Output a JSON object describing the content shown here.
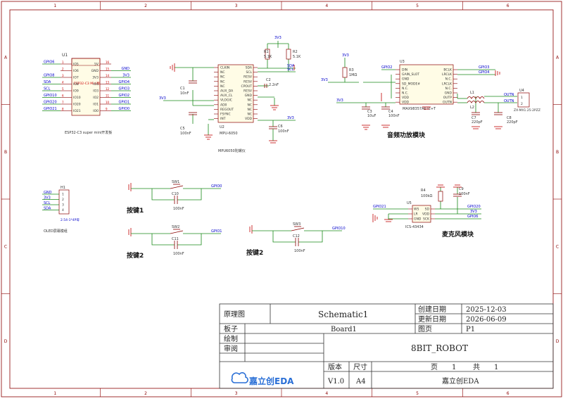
{
  "frame": {
    "cols": [
      "1",
      "2",
      "3",
      "4",
      "5",
      "6"
    ],
    "rows": [
      "A",
      "B",
      "C",
      "D"
    ]
  },
  "colors": {
    "border": "#8b0000",
    "wire": "#1a8a1a",
    "net": "#0000cc",
    "label": "#cc0000",
    "text": "#333333",
    "ground": "#c00000"
  },
  "esp32": {
    "ref": "U1",
    "name": "ESP32-C3\nMini板",
    "caption": "ESP32-C3 super mini开发板",
    "pins_left": [
      "IO5",
      "IO6",
      "IO7",
      "IO8",
      "IO9",
      "IO10",
      "IO20",
      "IO21"
    ],
    "pins_right": [
      "5V",
      "GND",
      "3V3",
      "IO4",
      "IO3",
      "IO2",
      "IO1",
      "IO0"
    ],
    "nums_left": [
      "1",
      "2",
      "3",
      "4",
      "5",
      "6",
      "7",
      "8"
    ],
    "nums_right": [
      "16",
      "15",
      "14",
      "13",
      "12",
      "11",
      "10",
      "9"
    ],
    "nets_left": [
      "GPIO6",
      "",
      "GPIO8",
      "SDA",
      "SCL",
      "GPIO10",
      "GPIO20",
      "GPIO21"
    ],
    "nets_right": [
      "GND",
      "3V3",
      "GPIO4",
      "GPIO3",
      "GPIO2",
      "GPIO1",
      "GPIO0",
      ""
    ]
  },
  "mpu": {
    "ref": "U2",
    "name": "MPU-6050",
    "caption": "MPU6050陀螺仪",
    "pins_left": [
      "CLKIN",
      "NC",
      "NC",
      "NC",
      "NC",
      "AUX_DA",
      "AUX_CL",
      "VLOGIC",
      "AD0",
      "REGOUT",
      "FSYNC",
      "INT"
    ],
    "pins_right": [
      "SDA",
      "SCL",
      "RESV",
      "RESV",
      "CPOUT",
      "RESV",
      "GND",
      "NC",
      "NC",
      "NC",
      "NC",
      "VDD"
    ],
    "net_sda": "SDA",
    "net_scl": "SCL",
    "net_3v3_right": "3V3",
    "net_3v3_left": "3V3",
    "net_3v3_top": "3V3",
    "r1": "R1",
    "r1v": "5.1K",
    "r2": "R2",
    "r2v": "5.1K",
    "c1": "C1",
    "c1v": "10nF",
    "c2": "C2",
    "c2v": "2.2nF",
    "c5": "C5",
    "c5v": "100nF",
    "c6": "C6",
    "c6v": "100nF"
  },
  "amp": {
    "ref": "U3",
    "name": "MAX98357AETE+T",
    "caption": "音频功放模块",
    "pins_left": [
      "DIN",
      "GAIN_SLOT",
      "GND",
      "SD_MODE#",
      "N.C.",
      "N.C.",
      "VDD",
      "VDD"
    ],
    "pins_right": [
      "BCLK",
      "LRCLK",
      "N.C.",
      "LRCLK",
      "N.C.",
      "GND",
      "OUTP",
      "OUTN"
    ],
    "net_in": "GPIO2",
    "net_bclk": "GPIO3",
    "net_lrclk": "GPIO4",
    "net_3v3_a": "3V3",
    "net_3v3_b": "3V3",
    "net_3v3_top": "3V3",
    "r3": "R3",
    "r3v": "1MΩ",
    "c3": "C3",
    "c3v": "10uF",
    "c4": "C4",
    "c4v": "100nF",
    "l1": "L1",
    "l2": "L2",
    "c7": "C7",
    "c7v": "220pF",
    "c8": "C8",
    "c8v": "220pF",
    "u4": "U4",
    "u4name": "ZX-MX1.25-2PZZ",
    "outp": "OUTN",
    "outn": "OUTN"
  },
  "oled": {
    "ref": "H1",
    "nets": [
      "GND",
      "3V3",
      "SCL",
      "SDA"
    ],
    "nums": [
      "1",
      "2",
      "3",
      "4"
    ],
    "part": "2.54-1*4P母",
    "caption": "OLED屏幕模组"
  },
  "keys": [
    {
      "sw": "SW1",
      "cap": "C10",
      "capv": "100nF",
      "net": "GPIO0",
      "caption": "按键1"
    },
    {
      "sw": "SW2",
      "cap": "C11",
      "capv": "100nF",
      "net": "GPIO1",
      "caption": "按键2"
    },
    {
      "sw": "SW3",
      "cap": "C12",
      "capv": "100nF",
      "net": "GPIO10",
      "caption": "按键2"
    }
  ],
  "mic": {
    "ref": "U5",
    "name": "ICS-43434",
    "caption": "麦克风模块",
    "pins_left": [
      "WS",
      "LR",
      "GND"
    ],
    "pins_right": [
      "SD",
      "VDD",
      "SCK"
    ],
    "net_ws": "GPIO21",
    "net_sd": "GPIO20",
    "net_vdd": "3V3",
    "net_sck": "GPIO6",
    "r4": "R4",
    "r4v": "100kΩ",
    "c9": "C9",
    "c9v": "100nF"
  },
  "titleblock": {
    "l_schematic": "原理图",
    "schematic": "Schematic1",
    "l_created": "创建日期",
    "created": "2025-12-03",
    "l_updated": "更新日期",
    "updated": "2026-06-09",
    "l_board": "板子",
    "board": "Board1",
    "l_page": "图页",
    "page": "P1",
    "l_drawn": "绘制",
    "l_review": "审阅",
    "project": "8BIT_ROBOT",
    "l_version": "版本",
    "l_size": "尺寸",
    "l_sheet": "页",
    "sheet": "1",
    "l_total": "共",
    "total": "1",
    "logo": "嘉立创EDA",
    "version": "V1.0",
    "size": "A4",
    "company": "嘉立创EDA"
  }
}
